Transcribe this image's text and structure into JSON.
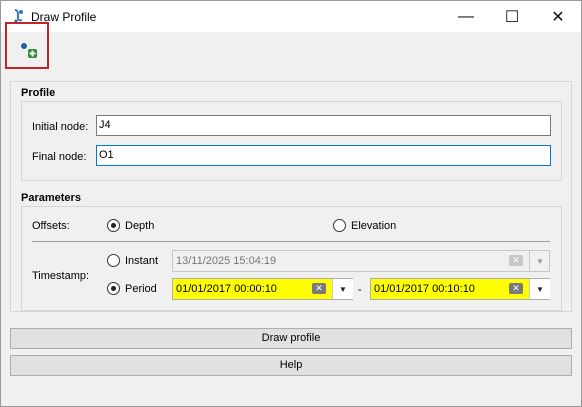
{
  "window": {
    "title": "Draw Profile",
    "icon": "qgis-python-plugin-icon",
    "controls": {
      "minimize": "—",
      "maximize": "☐",
      "close": "✕"
    }
  },
  "toolbar": {
    "add_node_icon": "add-node-icon"
  },
  "profile": {
    "title": "Profile",
    "initial_node_label": "Initial node:",
    "initial_node_value": "J4",
    "final_node_label": "Final node:",
    "final_node_value": "O1"
  },
  "parameters": {
    "title": "Parameters",
    "offsets_label": "Offsets:",
    "depth_label": "Depth",
    "elevation_label": "Elevation",
    "offset_selected": "Depth",
    "timestamp_label": "Timestamp:",
    "instant_label": "Instant",
    "instant_value": "13/11/2025 15:04:19",
    "period_label": "Period",
    "period_start": "01/01/2017 00:00:10",
    "period_separator": "-",
    "period_end": "01/01/2017 00:10:10",
    "timestamp_selected": "Period"
  },
  "buttons": {
    "draw_profile": "Draw profile",
    "help": "Help"
  },
  "colors": {
    "highlight_box": "#c0272d",
    "period_field_bg": "#ffff00",
    "focus_border": "#0078d7"
  }
}
